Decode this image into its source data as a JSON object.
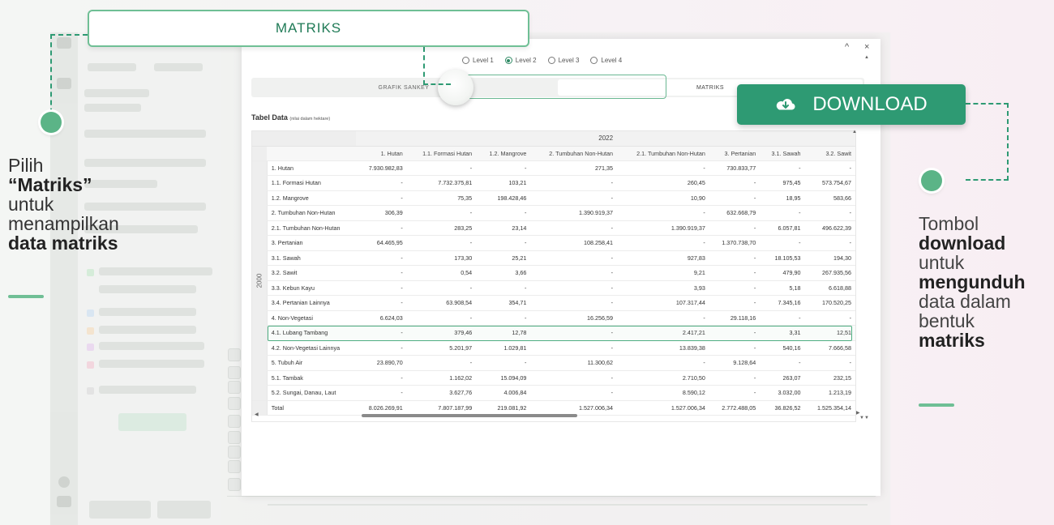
{
  "annotation": {
    "matriks_label": "MATRIKS",
    "download_label": "DOWNLOAD",
    "left_caption": {
      "p1": "Pilih",
      "p2_quote_open": "“",
      "p2_bold": "Matriks",
      "p2_quote_close": "”",
      "p3": "untuk",
      "p4": "menampilkan",
      "p5_bold": "data matriks"
    },
    "right_caption": {
      "p1": "Tombol",
      "p2_bold": "download",
      "p3": "untuk",
      "p4_bold": "mengunduh",
      "p5": "data dalam",
      "p6": "bentuk",
      "p7_bold": "matriks"
    },
    "accent_color": "#2e9a73"
  },
  "modal": {
    "controls": {
      "minimize": "^",
      "close": "×"
    },
    "levels": [
      {
        "label": "Level 1",
        "selected": false
      },
      {
        "label": "Level 2",
        "selected": true
      },
      {
        "label": "Level 3",
        "selected": false
      },
      {
        "label": "Level 4",
        "selected": false
      }
    ],
    "tabs": [
      {
        "label": "GRAFIK SANKEY",
        "active": false
      },
      {
        "label": "MATRIKS",
        "active": true
      }
    ],
    "table_title": "Tabel Data",
    "table_subtitle": "(nilai dalam hektare)",
    "year_col": "2022",
    "year_row": "2000",
    "columns": [
      "1. Hutan",
      "1.1. Formasi Hutan",
      "1.2. Mangrove",
      "2. Tumbuhan Non-Hutan",
      "2.1. Tumbuhan Non-Hutan",
      "3. Pertanian",
      "3.1. Sawah",
      "3.2. Sawit"
    ],
    "rows": [
      {
        "label": "1. Hutan",
        "values": [
          "7.930.982,83",
          "-",
          "-",
          "271,35",
          "-",
          "730.833,77",
          "-",
          "-"
        ]
      },
      {
        "label": "1.1. Formasi Hutan",
        "values": [
          "-",
          "7.732.375,81",
          "103,21",
          "-",
          "260,45",
          "-",
          "975,45",
          "573.754,67"
        ]
      },
      {
        "label": "1.2. Mangrove",
        "values": [
          "-",
          "75,35",
          "198.428,46",
          "-",
          "10,90",
          "-",
          "18,95",
          "583,66"
        ]
      },
      {
        "label": "2. Tumbuhan Non-Hutan",
        "values": [
          "306,39",
          "-",
          "-",
          "1.390.919,37",
          "-",
          "632.668,79",
          "-",
          "-"
        ]
      },
      {
        "label": "2.1. Tumbuhan Non-Hutan",
        "values": [
          "-",
          "283,25",
          "23,14",
          "-",
          "1.390.919,37",
          "-",
          "6.057,81",
          "496.622,39"
        ]
      },
      {
        "label": "3. Pertanian",
        "values": [
          "64.465,95",
          "-",
          "-",
          "108.258,41",
          "-",
          "1.370.738,70",
          "-",
          "-"
        ]
      },
      {
        "label": "3.1. Sawah",
        "values": [
          "-",
          "173,30",
          "25,21",
          "-",
          "927,83",
          "-",
          "18.105,53",
          "194,30"
        ]
      },
      {
        "label": "3.2. Sawit",
        "values": [
          "-",
          "0,54",
          "3,66",
          "-",
          "9,21",
          "-",
          "479,90",
          "267.935,56"
        ]
      },
      {
        "label": "3.3. Kebun Kayu",
        "values": [
          "-",
          "-",
          "-",
          "-",
          "3,93",
          "-",
          "5,18",
          "6.618,88"
        ]
      },
      {
        "label": "3.4. Pertanian Lainnya",
        "values": [
          "-",
          "63.908,54",
          "354,71",
          "-",
          "107.317,44",
          "-",
          "7.345,16",
          "170.520,25"
        ]
      },
      {
        "label": "4. Non-Vegetasi",
        "values": [
          "6.624,03",
          "-",
          "-",
          "16.256,59",
          "-",
          "29.118,16",
          "-",
          "-"
        ]
      },
      {
        "label": "4.1. Lubang Tambang",
        "values": [
          "-",
          "379,46",
          "12,78",
          "-",
          "2.417,21",
          "-",
          "3,31",
          "12,51"
        ]
      },
      {
        "label": "4.2. Non-Vegetasi Lainnya",
        "values": [
          "-",
          "5.201,97",
          "1.029,81",
          "-",
          "13.839,38",
          "-",
          "540,16",
          "7.666,58"
        ]
      },
      {
        "label": "5. Tubuh Air",
        "values": [
          "23.890,70",
          "-",
          "-",
          "11.300,62",
          "-",
          "9.128,64",
          "-",
          "-"
        ]
      },
      {
        "label": "5.1. Tambak",
        "values": [
          "-",
          "1.162,02",
          "15.094,09",
          "-",
          "2.710,50",
          "-",
          "263,07",
          "232,15"
        ]
      },
      {
        "label": "5.2. Sungai, Danau, Laut",
        "values": [
          "-",
          "3.627,76",
          "4.006,84",
          "-",
          "8.590,12",
          "-",
          "3.032,00",
          "1.213,19"
        ]
      },
      {
        "label": "Total",
        "values": [
          "8.026.269,91",
          "7.807.187,99",
          "219.081,92",
          "1.527.006,34",
          "1.527.006,34",
          "2.772.488,05",
          "36.826,52",
          "1.525.354,14"
        ]
      }
    ],
    "highlighted_row": "4.1. Lubang Tambang"
  }
}
